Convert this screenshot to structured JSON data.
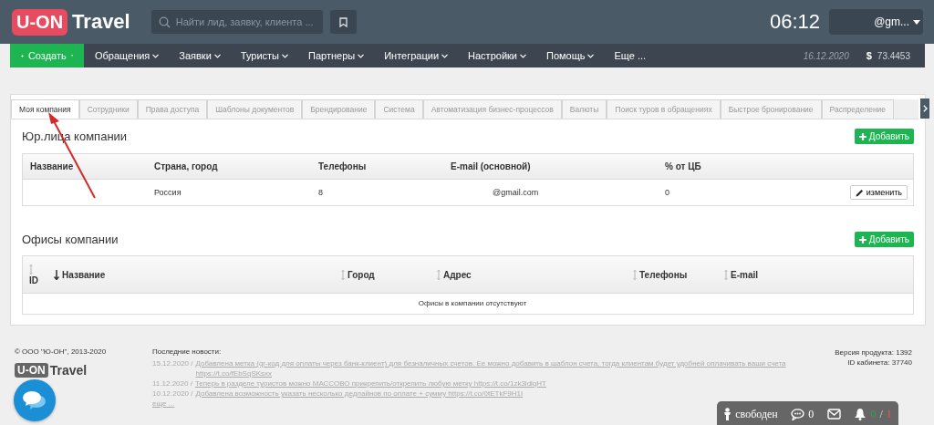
{
  "header": {
    "logo_badge": "U-ON",
    "logo_text": "Travel",
    "search": {
      "placeholder": "Найти лид, заявку, клиента ..."
    },
    "clock": "06:12",
    "user": "@gm..."
  },
  "nav": {
    "create": "Создать",
    "items": [
      {
        "label": "Обращения",
        "dropdown": true
      },
      {
        "label": "Заявки",
        "dropdown": true
      },
      {
        "label": "Туристы",
        "dropdown": true
      },
      {
        "label": "Партнеры",
        "dropdown": true
      },
      {
        "label": "Интеграции",
        "dropdown": true
      },
      {
        "label": "Настройки",
        "dropdown": true
      },
      {
        "label": "Помощь",
        "dropdown": true
      },
      {
        "label": "Еще ...",
        "dropdown": false
      }
    ],
    "date": "16.12.2020",
    "currency_symbol": "$",
    "rate": "73.4453"
  },
  "tabs": [
    {
      "label": "Моя компания",
      "selected": true
    },
    {
      "label": "Сотрудники",
      "selected": false
    },
    {
      "label": "Права доступа",
      "selected": false
    },
    {
      "label": "Шаблоны документов",
      "selected": false
    },
    {
      "label": "Брендирование",
      "selected": false
    },
    {
      "label": "Система",
      "selected": false
    },
    {
      "label": "Автоматизация бизнес-процессов",
      "selected": false
    },
    {
      "label": "Валюты",
      "selected": false
    },
    {
      "label": "Поиск туров в обращениях",
      "selected": false
    },
    {
      "label": "Быстрое бронирование",
      "selected": false
    },
    {
      "label": "Распределение",
      "selected": false
    }
  ],
  "legal": {
    "title": "Юр.лица компании",
    "add": "Добавить",
    "columns": [
      "Название",
      "Страна, город",
      "Телефоны",
      "E-mail (основной)",
      "% от ЦБ"
    ],
    "rows": [
      {
        "country": "Россия",
        "phones": "8",
        "email": "@gmail.com",
        "percent": "0",
        "action": "изменить"
      }
    ]
  },
  "offices": {
    "title": "Офисы компании",
    "add": "Добавить",
    "columns": [
      {
        "label": "ID",
        "sorted": false
      },
      {
        "label": "Название",
        "sorted": true
      },
      {
        "label": "Город",
        "sorted": false
      },
      {
        "label": "Адрес",
        "sorted": false
      },
      {
        "label": "Телефоны",
        "sorted": false
      },
      {
        "label": "E-mail",
        "sorted": false
      }
    ],
    "empty": "Офисы в компании отсутствуют"
  },
  "footer": {
    "copyright": "© ООО \"Ю-ОН\", 2013-2020",
    "logo_badge": "U-ON",
    "logo_text": "Travel",
    "news_title": "Последние новости:",
    "news": [
      {
        "date": "15.12.2020 /",
        "text": "Добавлена метка (qr-код для оплаты через банк-клиент) для безналичных счетов. Ее можно добавить в шаблон счета, тогда клиентам будет удобней оплачивать ваши счета https://t.co/fEbSqSKsxx"
      },
      {
        "date": "11.12.2020 /",
        "text": "Теперь в разделе туристов можно МАССОВО прикрепить/открепить любую метку https://t.co/1zk3idlqHT"
      },
      {
        "date": "10.12.2020 /",
        "text": "Добавлена возможность указать несколько дедлайнов по оплате + сумму https://t.co/0tETkF9H1I"
      }
    ],
    "more": "еще ...",
    "version": "Версия продукта: 1392",
    "cabinet": "ID кабинета: 37740"
  },
  "status_bar": {
    "status": "свободен",
    "messages": "0",
    "done": "0",
    "slash": "/",
    "total": "1"
  }
}
